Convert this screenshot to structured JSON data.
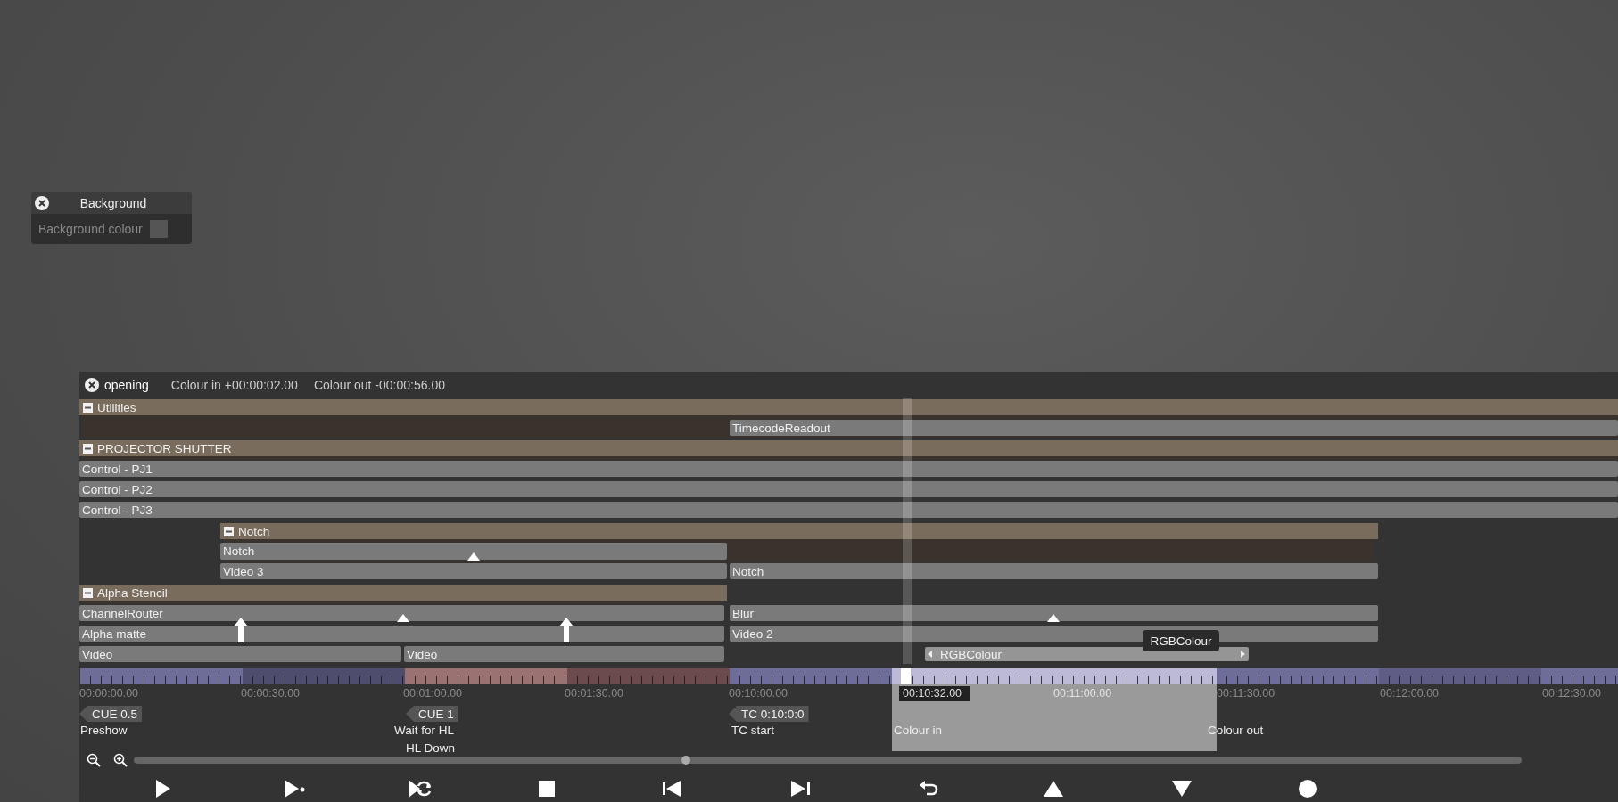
{
  "background_panel": {
    "title": "Background",
    "property": "Background colour"
  },
  "timeline": {
    "title": "opening",
    "colour_in": "Colour in +00:00:02.00",
    "colour_out": "Colour out -00:00:56.00"
  },
  "tracks": [
    {
      "kind": "group",
      "label": "Utilities",
      "expanded": true
    },
    {
      "kind": "clip",
      "label": "TimecodeReadout"
    },
    {
      "kind": "group",
      "label": "PROJECTOR SHUTTER",
      "expanded": true
    },
    {
      "kind": "clip",
      "label": "Control - PJ1"
    },
    {
      "kind": "clip",
      "label": "Control - PJ2"
    },
    {
      "kind": "clip",
      "label": "Control - PJ3"
    },
    {
      "kind": "group",
      "label": "Notch",
      "expanded": true
    },
    {
      "kind": "clip",
      "label": "Notch"
    },
    {
      "kind": "clip",
      "label": "Video 3"
    },
    {
      "kind": "clip",
      "label": "Notch"
    },
    {
      "kind": "group",
      "label": "Alpha Stencil",
      "expanded": true
    },
    {
      "kind": "clip",
      "label": "ChannelRouter"
    },
    {
      "kind": "clip",
      "label": "Blur"
    },
    {
      "kind": "clip",
      "label": "Alpha matte"
    },
    {
      "kind": "clip",
      "label": "Video 2"
    },
    {
      "kind": "clip",
      "label": "Video"
    },
    {
      "kind": "clip",
      "label": "Video"
    },
    {
      "kind": "selected_clip",
      "label": "RGBColour"
    }
  ],
  "tooltip": "RGBColour",
  "ruler_labels": [
    "00:00:00.00",
    "00:00:30.00",
    "00:01:00.00",
    "00:01:30.00",
    "00:10:00.00",
    "00:11:00.00",
    "00:11:30.00",
    "00:12:00.00",
    "00:12:30.00"
  ],
  "playhead": "00:10:32.00",
  "cues": [
    {
      "tag": "CUE 0.5",
      "name": "Preshow"
    },
    {
      "tag": "CUE 1",
      "name": "Wait for HL",
      "note": "HL Down"
    },
    {
      "tag": "TC 0:10:0:0",
      "name": "TC start"
    }
  ],
  "range": {
    "in_label": "Colour in",
    "out_label": "Colour out"
  }
}
